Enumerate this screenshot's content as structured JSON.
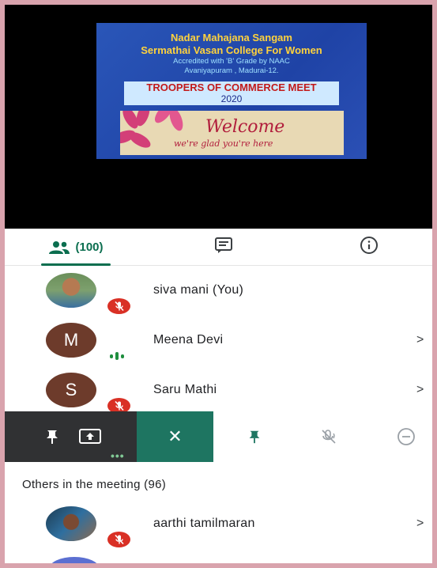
{
  "slide": {
    "line1": "Nadar Mahajana Sangam",
    "line2": "Sermathai Vasan College For Women",
    "line3": "Accredited with 'B' Grade by NAAC",
    "line4": "Avaniyapuram , Madurai-12.",
    "event": "TROOPERS OF COMMERCE MEET",
    "year": "2020",
    "welcome": "Welcome",
    "welcome_sub": "we're glad you're here"
  },
  "tabs": {
    "people_icon": "people-icon",
    "people_count": "(100)",
    "chat_icon": "chat-icon",
    "info_icon": "info-icon"
  },
  "participants": [
    {
      "name": "siva mani (You)",
      "avatar": "photo",
      "status": "muted"
    },
    {
      "name": "Meena Devi",
      "avatar": "M",
      "status": "speaking",
      "chevron": ">"
    },
    {
      "name": "Saru Mathi",
      "avatar": "S",
      "status": "muted",
      "chevron": ">"
    }
  ],
  "action_bar": {
    "close": "✕",
    "more": "•••",
    "icons": [
      "pin-icon",
      "present-screen-icon",
      "close-icon",
      "pin-icon",
      "mute-icon",
      "remove-icon"
    ]
  },
  "others": {
    "heading": "Others in the meeting (96)",
    "items": [
      {
        "name": "aarthi tamilmaran",
        "avatar": "photo",
        "status": "muted",
        "chevron": ">"
      }
    ]
  },
  "colors": {
    "accent": "#0b6e4f",
    "mute_red": "#d93025",
    "action_green": "#1e7561",
    "frame_pink": "#d9a3ad"
  }
}
